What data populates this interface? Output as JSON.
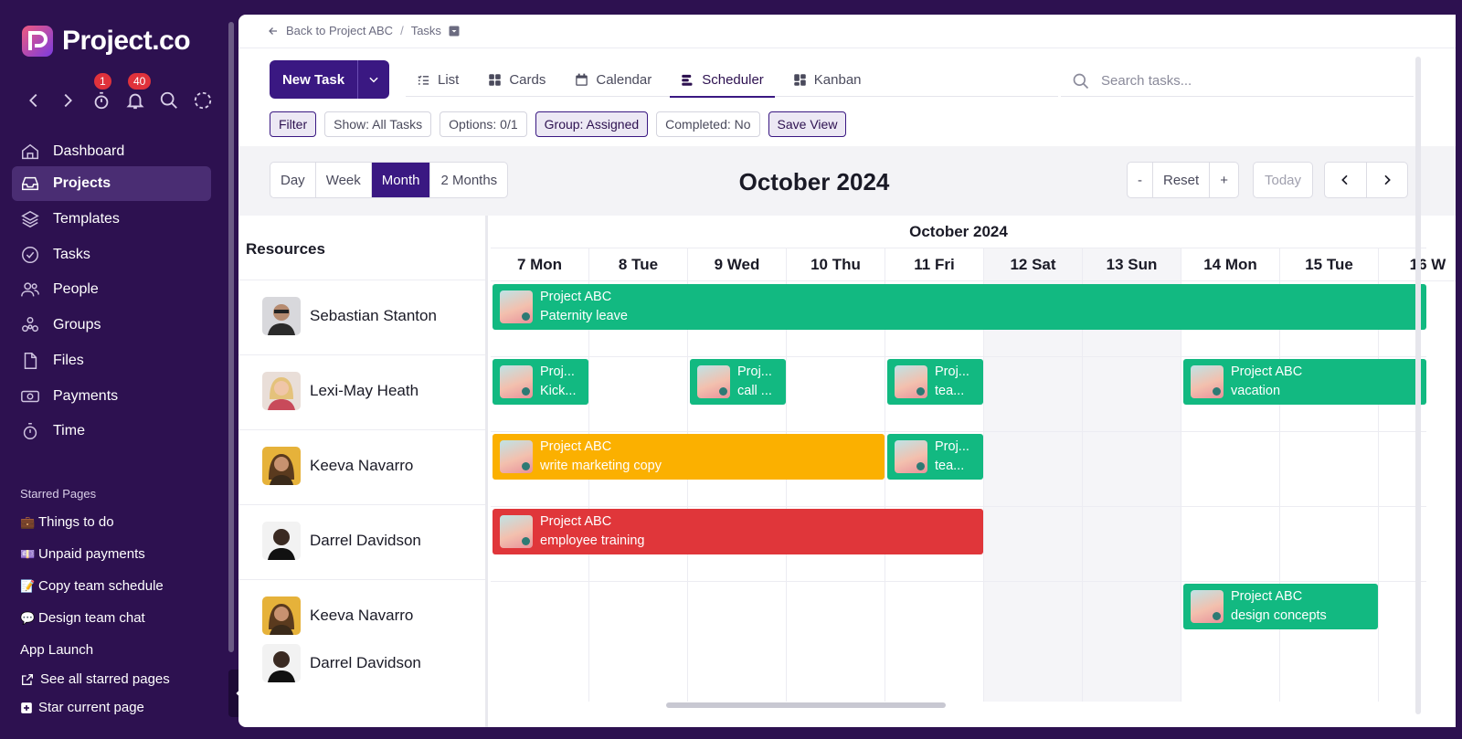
{
  "sidebar": {
    "brand": "Project.co",
    "badges": {
      "timer": "1",
      "notifications": "40"
    },
    "nav": [
      {
        "label": "Dashboard",
        "icon": "home-icon"
      },
      {
        "label": "Projects",
        "icon": "inbox-icon",
        "active": true
      },
      {
        "label": "Templates",
        "icon": "layers-icon"
      },
      {
        "label": "Tasks",
        "icon": "check-circle-icon"
      },
      {
        "label": "People",
        "icon": "users-icon"
      },
      {
        "label": "Groups",
        "icon": "groups-icon"
      },
      {
        "label": "Files",
        "icon": "file-icon"
      },
      {
        "label": "Payments",
        "icon": "payments-icon"
      },
      {
        "label": "Time",
        "icon": "stopwatch-icon"
      }
    ],
    "starred_title": "Starred Pages",
    "starred": [
      {
        "emoji": "💼",
        "label": "Things to do"
      },
      {
        "emoji": "💷",
        "label": "Unpaid payments"
      },
      {
        "emoji": "📝",
        "label": "Copy team schedule"
      },
      {
        "emoji": "💬",
        "label": "Design team chat"
      },
      {
        "emoji": "",
        "label": "App Launch"
      }
    ],
    "see_all": "See all starred pages",
    "star_current": "Star current page"
  },
  "breadcrumb": {
    "back": "Back to Project ABC",
    "current": "Tasks"
  },
  "toolbar": {
    "new_task": "New Task",
    "views": [
      {
        "label": "List",
        "icon": "list-icon"
      },
      {
        "label": "Cards",
        "icon": "cards-icon"
      },
      {
        "label": "Calendar",
        "icon": "calendar-icon"
      },
      {
        "label": "Scheduler",
        "icon": "scheduler-icon",
        "active": true
      },
      {
        "label": "Kanban",
        "icon": "kanban-icon"
      }
    ],
    "search_placeholder": "Search tasks..."
  },
  "filters": [
    {
      "label": "Filter",
      "on": true
    },
    {
      "label": "Show: All Tasks",
      "on": false
    },
    {
      "label": "Options: 0/1",
      "on": false
    },
    {
      "label": "Group: Assigned",
      "on": true
    },
    {
      "label": "Completed: No",
      "on": false
    },
    {
      "label": "Save View",
      "on": true
    }
  ],
  "calendar": {
    "ranges": [
      "Day",
      "Week",
      "Month",
      "2 Months"
    ],
    "active_range": "Month",
    "title": "October 2024",
    "zoom": [
      "-",
      "Reset",
      "+"
    ],
    "today": "Today",
    "month_label": "October 2024",
    "days": [
      {
        "label": "7 Mon",
        "weekend": false
      },
      {
        "label": "8 Tue",
        "weekend": false
      },
      {
        "label": "9 Wed",
        "weekend": false
      },
      {
        "label": "10 Thu",
        "weekend": false
      },
      {
        "label": "11 Fri",
        "weekend": false
      },
      {
        "label": "12 Sat",
        "weekend": true
      },
      {
        "label": "13 Sun",
        "weekend": true
      },
      {
        "label": "14 Mon",
        "weekend": false
      },
      {
        "label": "15 Tue",
        "weekend": false
      },
      {
        "label": "16 W",
        "weekend": false
      }
    ]
  },
  "resources_title": "Resources",
  "resources": [
    {
      "names": [
        "Sebastian Stanton"
      ]
    },
    {
      "names": [
        "Lexi-May Heath"
      ]
    },
    {
      "names": [
        "Keeva Navarro"
      ]
    },
    {
      "names": [
        "Darrel Davidson"
      ]
    },
    {
      "names": [
        "Keeva Navarro",
        "Darrel Davidson"
      ]
    }
  ],
  "events": [
    {
      "row": 0,
      "start": 0,
      "span": 9.5,
      "color": "green",
      "line1": "Project ABC",
      "line2": "Paternity leave"
    },
    {
      "row": 1,
      "start": 0,
      "span": 1,
      "color": "green",
      "line1": "Proj...",
      "line2": "Kick..."
    },
    {
      "row": 1,
      "start": 2,
      "span": 1,
      "color": "green",
      "line1": "Proj...",
      "line2": "call ..."
    },
    {
      "row": 1,
      "start": 4,
      "span": 1,
      "color": "green",
      "line1": "Proj...",
      "line2": "tea..."
    },
    {
      "row": 1,
      "start": 7,
      "span": 2.5,
      "color": "green",
      "line1": "Project ABC",
      "line2": "vacation"
    },
    {
      "row": 2,
      "start": 0,
      "span": 4,
      "color": "orange",
      "line1": "Project ABC",
      "line2": "write marketing copy"
    },
    {
      "row": 2,
      "start": 4,
      "span": 1,
      "color": "green",
      "line1": "Proj...",
      "line2": "tea..."
    },
    {
      "row": 3,
      "start": 0,
      "span": 5,
      "color": "red",
      "line1": "Project ABC",
      "line2": "employee training"
    },
    {
      "row": 4,
      "start": 7,
      "span": 2,
      "color": "green",
      "line1": "Project ABC",
      "line2": "design concepts"
    }
  ]
}
